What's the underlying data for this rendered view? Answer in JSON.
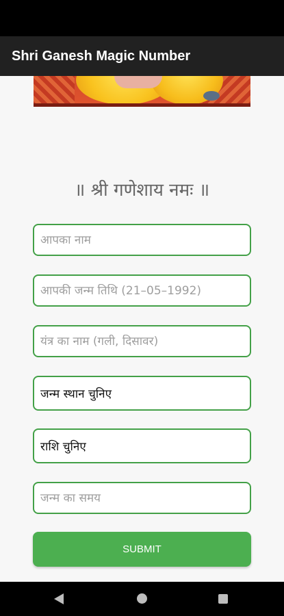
{
  "app": {
    "title": "Shri Ganesh Magic Number"
  },
  "heading": "॥ श्री गणेशाय नमः ॥",
  "form": {
    "name_placeholder": "आपका नाम",
    "dob_placeholder": "आपकी जन्म तिथि (21–05–1992)",
    "yantra_placeholder": "यंत्र का नाम (गली, दिसावर)",
    "birthplace_value": "जन्म स्थान चुनिए",
    "rashi_value": "राशि चुनिए",
    "birthtime_placeholder": "जन्म का समय",
    "submit_label": "SUBMIT"
  },
  "colors": {
    "accent": "#43a047",
    "button": "#4caf50",
    "app_bar": "#212121"
  },
  "icons": {
    "back": "back-icon",
    "home": "home-icon",
    "recents": "recents-icon"
  }
}
